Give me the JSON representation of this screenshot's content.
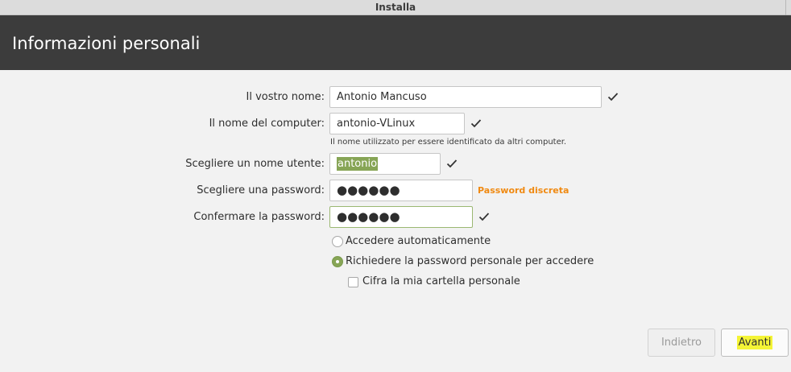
{
  "window": {
    "title": "Installa"
  },
  "header": {
    "title": "Informazioni personali"
  },
  "form": {
    "name": {
      "label": "Il vostro nome:",
      "value": "Antonio Mancuso"
    },
    "computer": {
      "label": "Il nome del computer:",
      "value": "antonio-VLinux",
      "hint": "Il nome utilizzato per essere identificato da altri computer."
    },
    "username": {
      "label": "Scegliere un nome utente:",
      "value": "antonio"
    },
    "password": {
      "label": "Scegliere una password:",
      "value": "●●●●●●",
      "strength": "Password discreta"
    },
    "confirm": {
      "label": "Confermare la password:",
      "value": "●●●●●●"
    }
  },
  "login_options": {
    "auto": {
      "label": "Accedere automaticamente",
      "selected": false
    },
    "require_password": {
      "label": "Richiedere la password personale per accedere",
      "selected": true
    },
    "encrypt_home": {
      "label": "Cifra la mia cartella personale",
      "checked": false
    }
  },
  "buttons": {
    "back": "Indietro",
    "next": "Avanti"
  },
  "colors": {
    "header_bg": "#3c3c3c",
    "accent_green": "#87a556",
    "strength_orange": "#f08a12",
    "highlight_yellow": "#f4f436"
  },
  "icons": {
    "valid": "check-icon"
  }
}
